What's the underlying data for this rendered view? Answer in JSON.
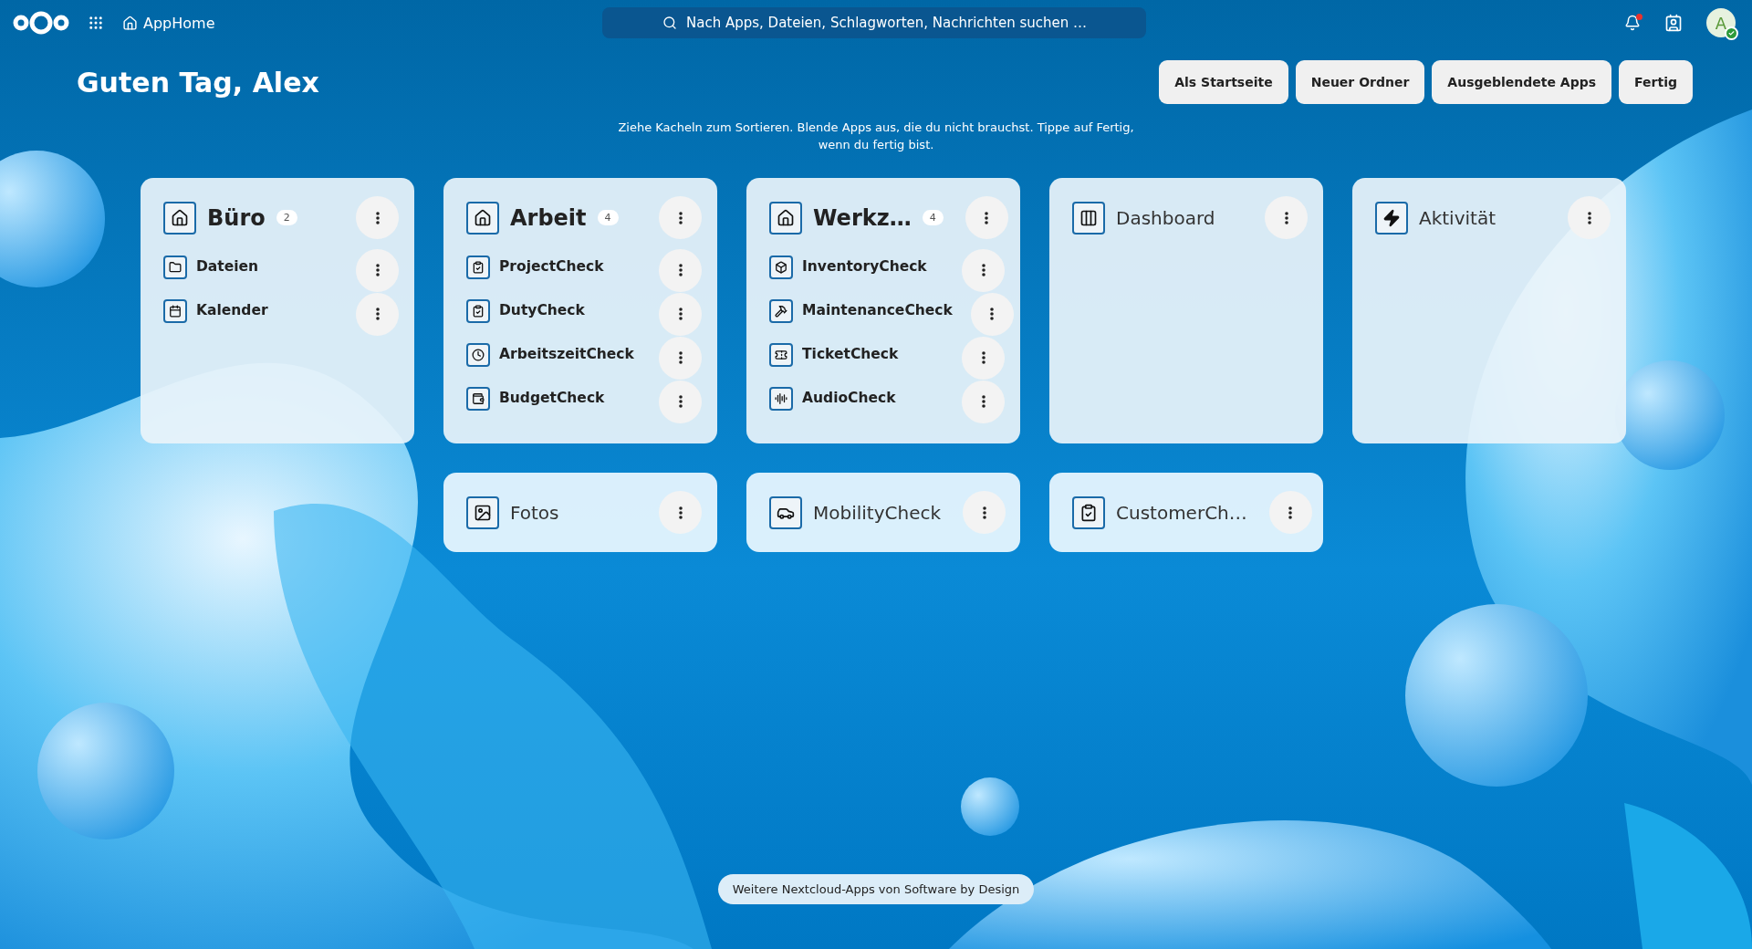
{
  "topbar": {
    "app_name": "AppHome",
    "search": {
      "placeholder": "Nach Apps, Dateien, Schlagworten, Nachrichten suchen …"
    },
    "notifications": {
      "unread": true
    },
    "avatar": {
      "initial": "A",
      "online": true
    }
  },
  "header": {
    "greeting": "Guten Tag, Alex",
    "buttons": [
      "Als Startseite",
      "Neuer Ordner",
      "Ausgeblendete Apps",
      "Fertig"
    ]
  },
  "hint": "Ziehe Kacheln zum Sortieren. Blende Apps aus, die du nicht brauchst. Tippe auf Fertig, wenn du fertig bist.",
  "tiles": [
    {
      "kind": "folder",
      "title": "Büro",
      "count": "2",
      "items": [
        "Dateien",
        "Kalender"
      ]
    },
    {
      "kind": "folder",
      "title": "Arbeit",
      "count": "4",
      "items": [
        "ProjectCheck",
        "DutyCheck",
        "ArbeitszeitCheck",
        "BudgetCheck"
      ]
    },
    {
      "kind": "folder",
      "title": "Werkz…",
      "count": "4",
      "items": [
        "InventoryCheck",
        "MaintenanceCheck",
        "TicketCheck",
        "AudioCheck"
      ]
    },
    {
      "kind": "widget",
      "title": "Dashboard"
    },
    {
      "kind": "widget",
      "title": "Aktivität"
    },
    {
      "kind": "app",
      "title": "Fotos"
    },
    {
      "kind": "app",
      "title": "MobilityCheck"
    },
    {
      "kind": "app",
      "title": "CustomerCh…"
    }
  ],
  "footer": {
    "link": "Weitere Nextcloud-Apps von Software by Design"
  }
}
